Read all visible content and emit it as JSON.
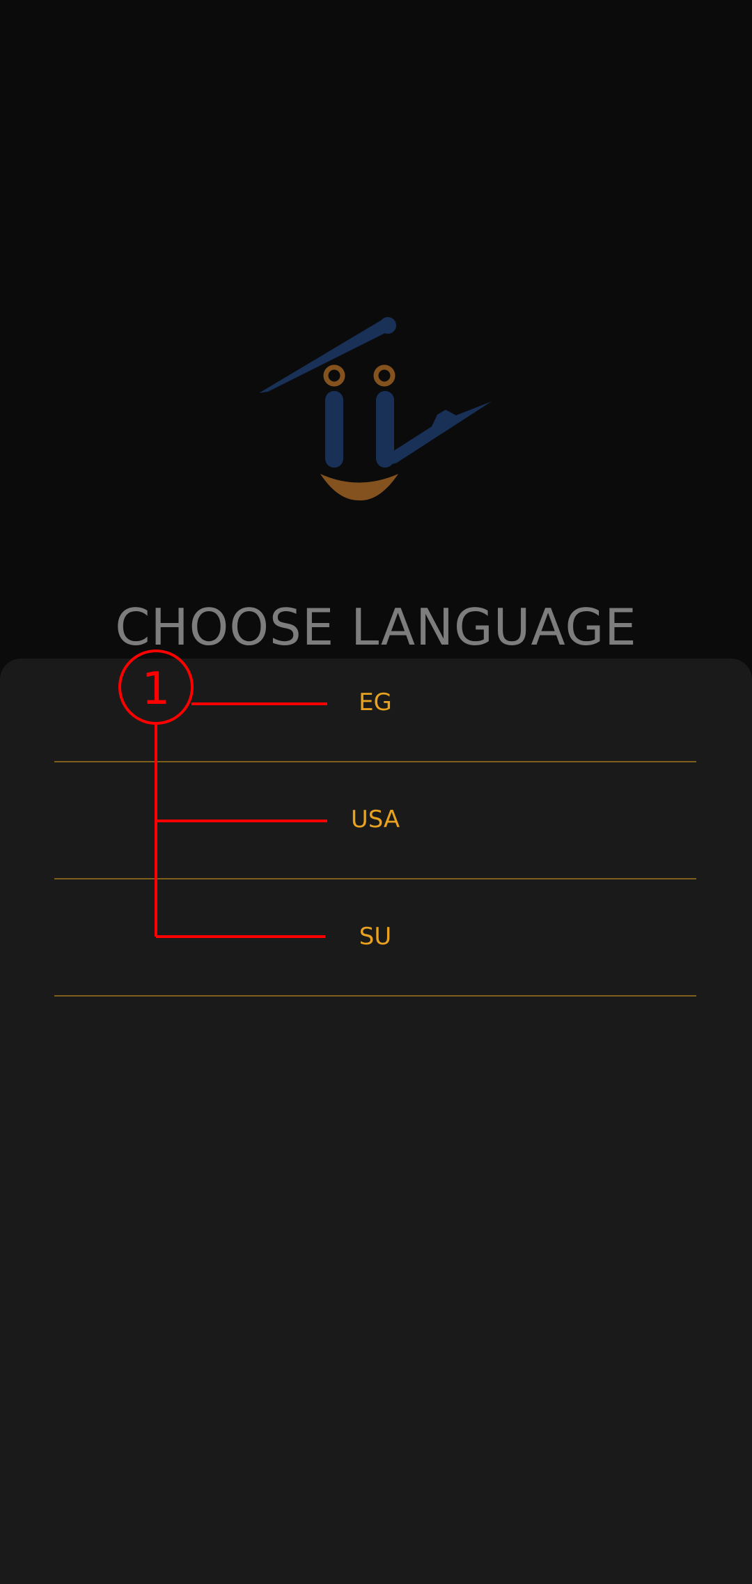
{
  "screen": {
    "title": "CHOOSE LANGUAGE"
  },
  "languages": [
    {
      "label": "EG"
    },
    {
      "label": "USA"
    },
    {
      "label": "SU"
    }
  ],
  "annotation": {
    "marker": "1",
    "color": "#ff0000"
  },
  "colors": {
    "background": "#0b0b0b",
    "sheet": "#1a1a1a",
    "title": "#7d7d7d",
    "accent": "#e8a21f",
    "divider": "#7f5f1c",
    "logo_blue": "#193057",
    "logo_orange": "#83521f"
  }
}
